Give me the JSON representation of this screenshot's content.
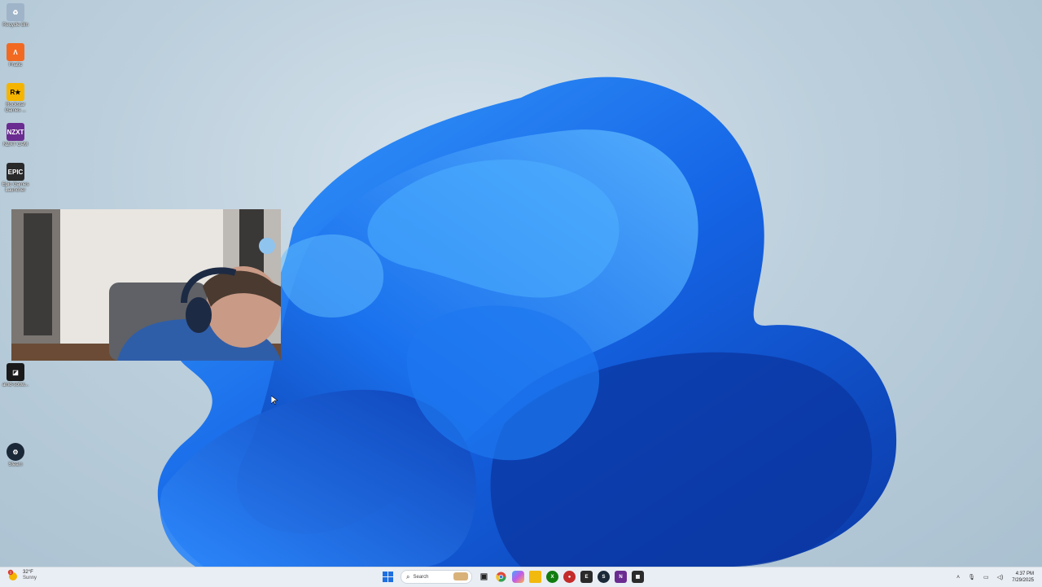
{
  "desktop": {
    "icons": [
      {
        "label": "Recycle Bin",
        "icon": "recycle-bin-icon",
        "color": "#9fb4c8"
      },
      {
        "label": "Fnatic",
        "icon": "fnatic-icon",
        "color": "#f26a21"
      },
      {
        "label": "Rockstar Games ...",
        "icon": "rockstar-icon",
        "color": "#f5b400"
      },
      {
        "label": "NZXT CAM",
        "icon": "nzxt-icon",
        "color": "#6b2c91"
      },
      {
        "label": "Epic Games Launcher",
        "icon": "epic-games-icon",
        "color": "#2a2a2a"
      },
      {
        "label": "amd-softw...",
        "icon": "amd-icon",
        "color": "#1a1a1a"
      },
      {
        "label": "Steam",
        "icon": "steam-icon",
        "color": "#1b2838"
      }
    ]
  },
  "taskbar": {
    "weather": {
      "temp": "32°F",
      "condition": "Sunny",
      "badge": "1"
    },
    "search": {
      "placeholder": "Search"
    },
    "apps": [
      {
        "name": "start-button",
        "glyph": "⊞",
        "color": "#1f6fe0"
      },
      {
        "name": "task-view-button",
        "glyph": "▣",
        "color": "#3a3f46"
      },
      {
        "name": "chrome-icon",
        "glyph": "◎",
        "color": "#de4a3a"
      },
      {
        "name": "copilot-icon",
        "glyph": "✿",
        "color": "#7a5ae6"
      },
      {
        "name": "file-explorer-icon",
        "glyph": "▭",
        "color": "#f2b90f"
      },
      {
        "name": "xbox-icon",
        "glyph": "X",
        "color": "#107c10"
      },
      {
        "name": "game-bar-icon",
        "glyph": "◉",
        "color": "#c42b2b"
      },
      {
        "name": "epic-games-taskbar-icon",
        "glyph": "E",
        "color": "#2a2a2a"
      },
      {
        "name": "steam-taskbar-icon",
        "glyph": "S",
        "color": "#1b2838"
      },
      {
        "name": "nzxt-taskbar-icon",
        "glyph": "N",
        "color": "#6b2c91"
      },
      {
        "name": "app-taskbar-icon",
        "glyph": "▦",
        "color": "#2b2b2b"
      }
    ],
    "clock": {
      "time": "4:37 PM",
      "date": "7/29/2025"
    }
  }
}
